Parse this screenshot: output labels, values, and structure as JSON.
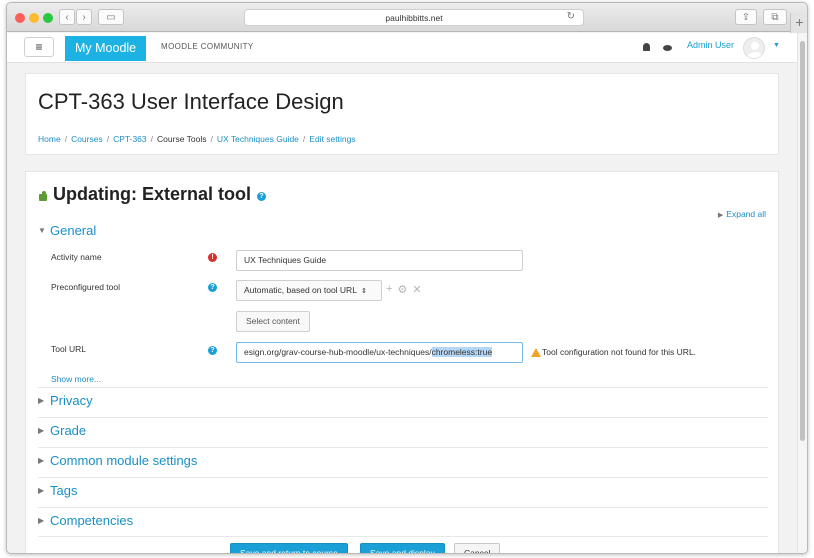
{
  "browser": {
    "url": "paulhibbitts.net",
    "colors": {
      "close": "#fc5f57",
      "minimize": "#fdbc2e",
      "maximize": "#28c940"
    }
  },
  "navbar": {
    "brand": "My Moodle",
    "community": "MOODLE COMMUNITY",
    "user": "Admin User",
    "accent": "#1cb3e4"
  },
  "header": {
    "course_title": "CPT-363 User Interface Design",
    "breadcrumb": [
      "Home",
      "Courses",
      "CPT-363",
      "Course Tools",
      "UX Techniques Guide",
      "Edit settings"
    ],
    "separator": "/"
  },
  "form": {
    "title": "Updating: External tool",
    "expand_all": "Expand all",
    "section_general": "General",
    "fields": {
      "activity_name_label": "Activity name",
      "activity_name_value": "UX Techniques Guide",
      "preconfigured_label": "Preconfigured tool",
      "preconfigured_value": "Automatic, based on tool URL",
      "select_content": "Select content",
      "tool_url_label": "Tool URL",
      "tool_url_value": "esign.org/grav-course-hub-moodle/ux-techniques/",
      "tool_url_selected": "chromeless:true",
      "tool_url_warning": "Tool configuration not found for this URL."
    },
    "show_more": "Show more...",
    "sections": [
      "Privacy",
      "Grade",
      "Common module settings",
      "Tags",
      "Competencies"
    ],
    "buttons": {
      "save_return": "Save and return to course",
      "save_display": "Save and display",
      "cancel": "Cancel"
    }
  }
}
